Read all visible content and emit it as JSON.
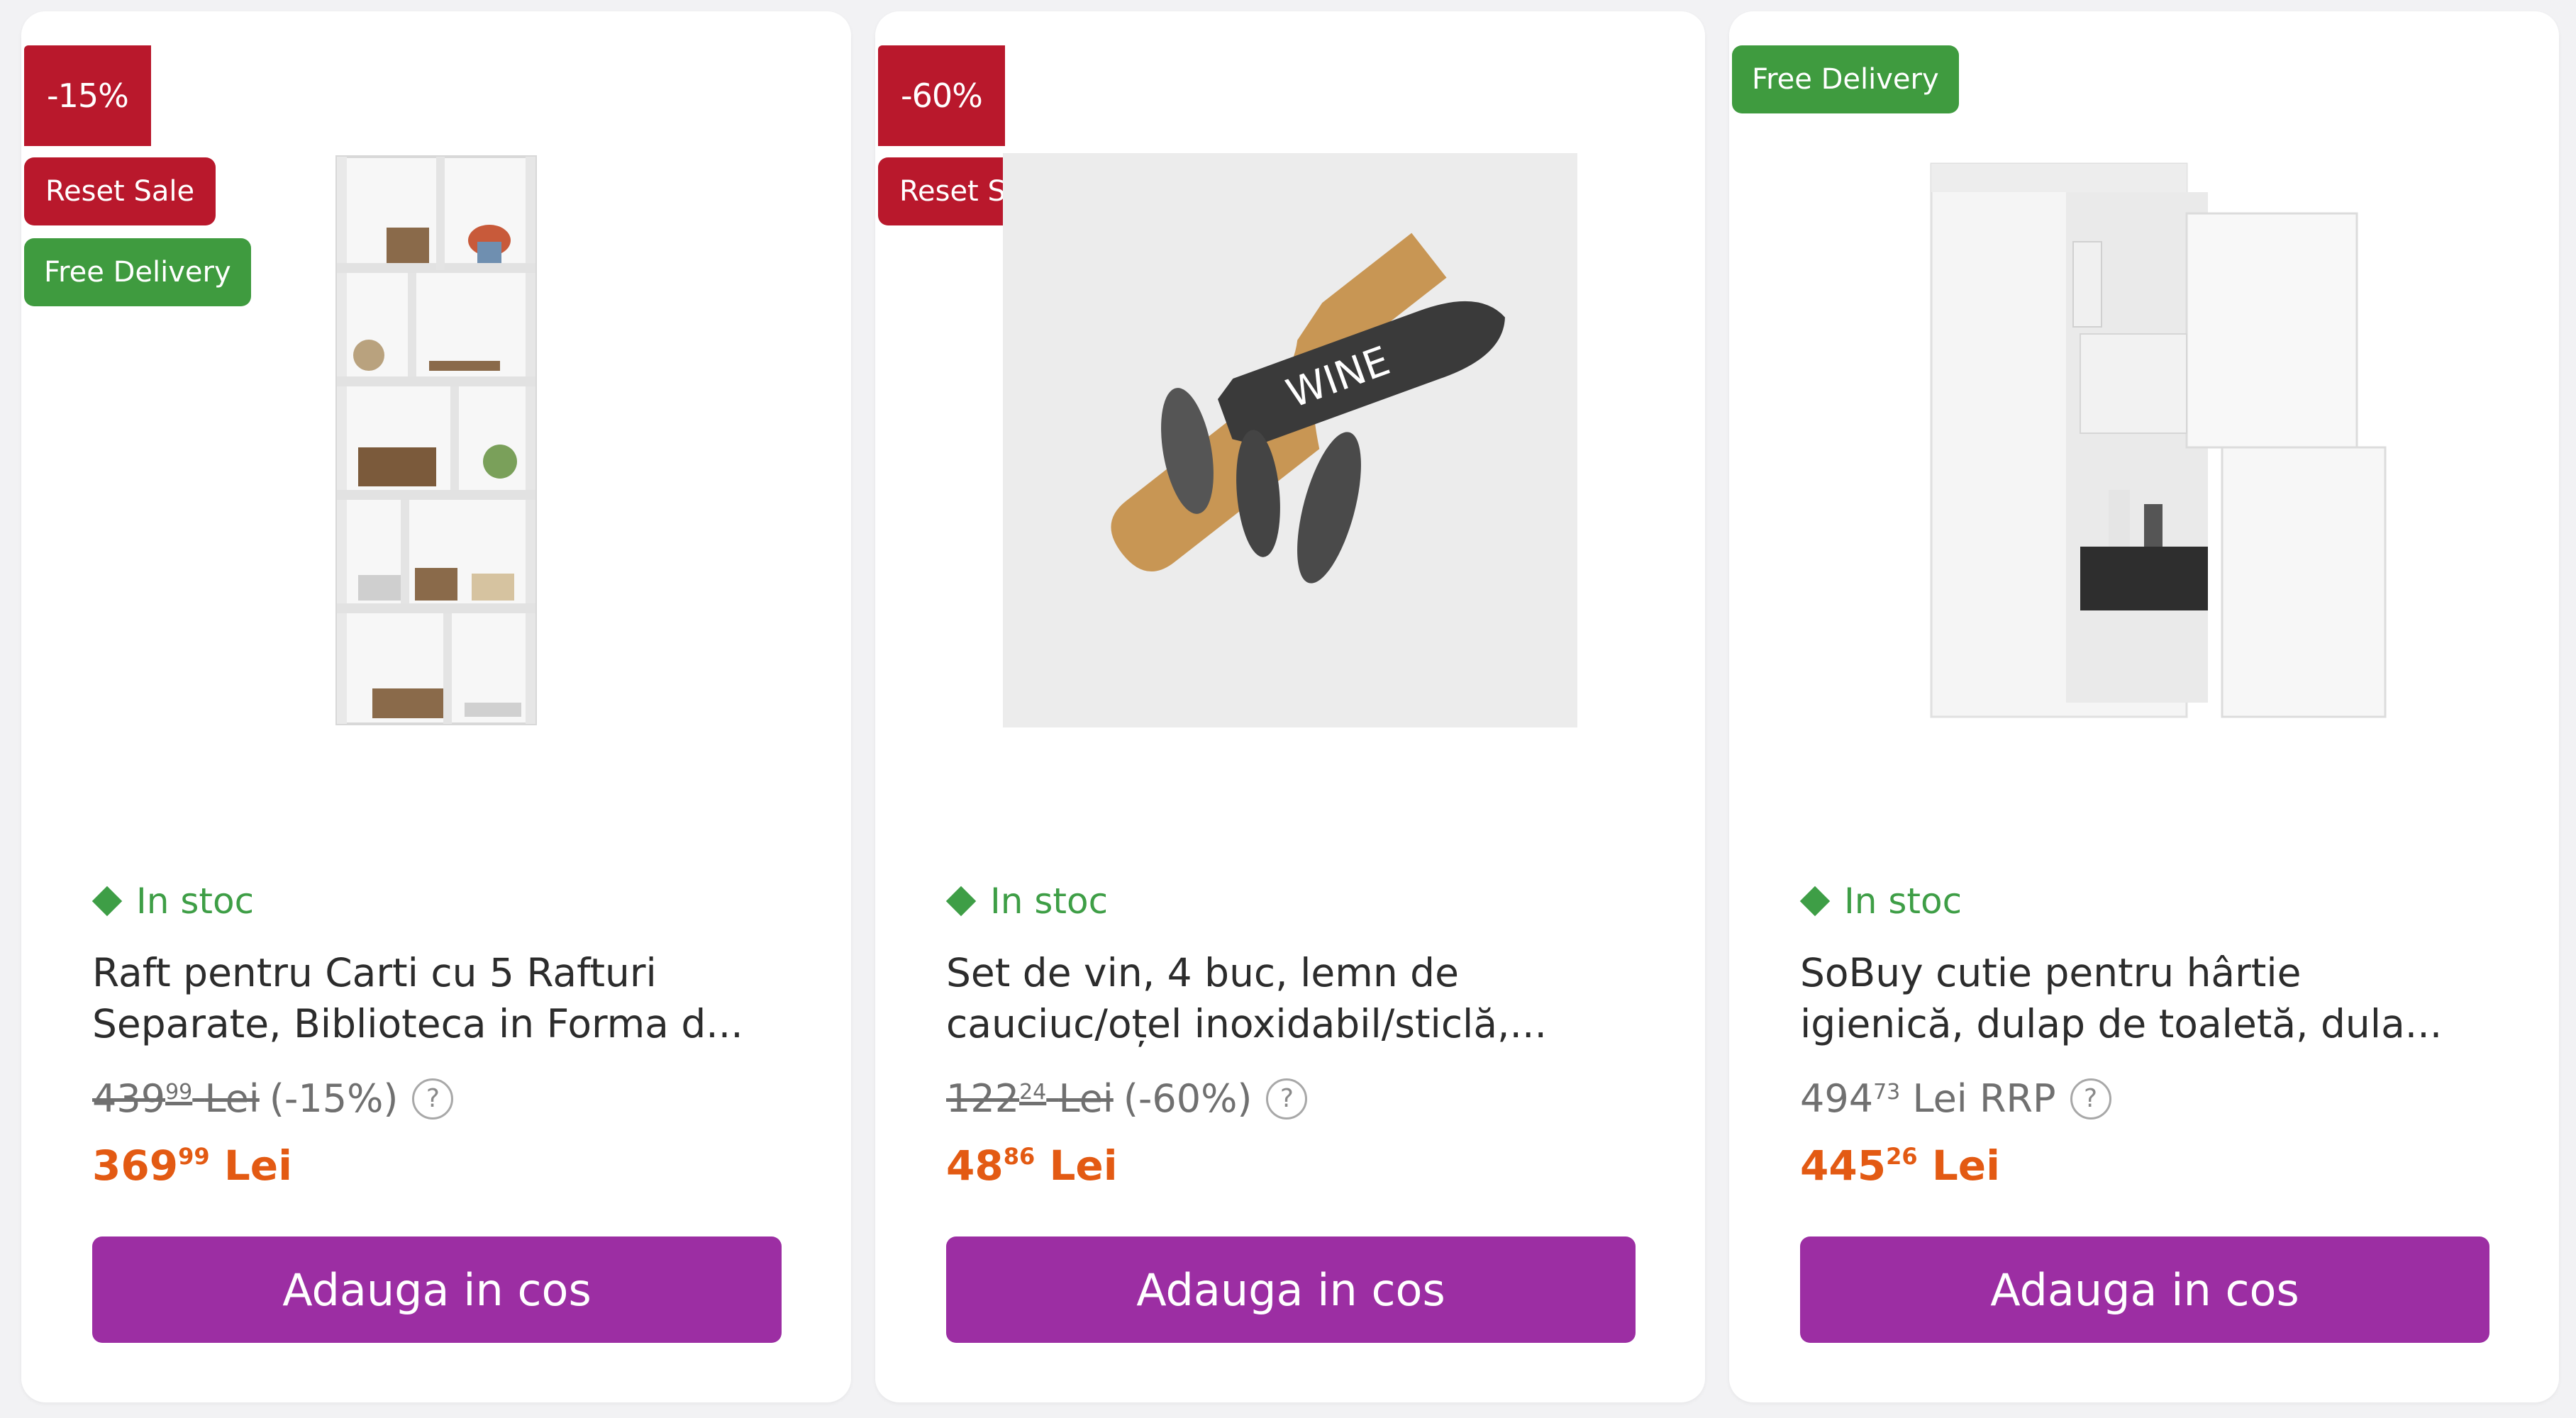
{
  "products": [
    {
      "badges": {
        "discount": "-15%",
        "sale": "Reset Sale",
        "delivery": "Free Delivery"
      },
      "stock": "In stoc",
      "title_line1": "Raft pentru Carti cu 5 Rafturi",
      "title_line2": "Separate, Biblioteca in Forma d...",
      "old_price_main": "439",
      "old_price_cents": "99",
      "old_price_currency": "Lei",
      "old_price_note": "(-15%)",
      "price_main": "369",
      "price_cents": "99",
      "price_currency": "Lei",
      "button": "Adauga in cos",
      "help": "?"
    },
    {
      "badges": {
        "discount": "-60%",
        "sale": "Reset Sale"
      },
      "stock": "In stoc",
      "title_line1": "Set de vin, 4 buc, lemn de",
      "title_line2": "cauciuc/oțel inoxidabil/sticlă,...",
      "old_price_main": "122",
      "old_price_cents": "24",
      "old_price_currency": "Lei",
      "old_price_note": "(-60%)",
      "price_main": "48",
      "price_cents": "86",
      "price_currency": "Lei",
      "button": "Adauga in cos",
      "help": "?",
      "image_text": "WINE"
    },
    {
      "badges": {
        "delivery": "Free Delivery"
      },
      "stock": "In stoc",
      "title_line1": "SoBuy cutie pentru hârtie",
      "title_line2": "igienică, dulap de toaletă, dula...",
      "old_price_main": "494",
      "old_price_cents": "73",
      "old_price_currency": "Lei RRP",
      "price_main": "445",
      "price_cents": "26",
      "price_currency": "Lei",
      "button": "Adauga in cos",
      "help": "?"
    }
  ],
  "colors": {
    "sale_red": "#b9182c",
    "delivery_green": "#3f9b3f",
    "stock_green": "#3e9e46",
    "price_orange": "#e35a13",
    "cart_purple": "#9c2ea3"
  }
}
